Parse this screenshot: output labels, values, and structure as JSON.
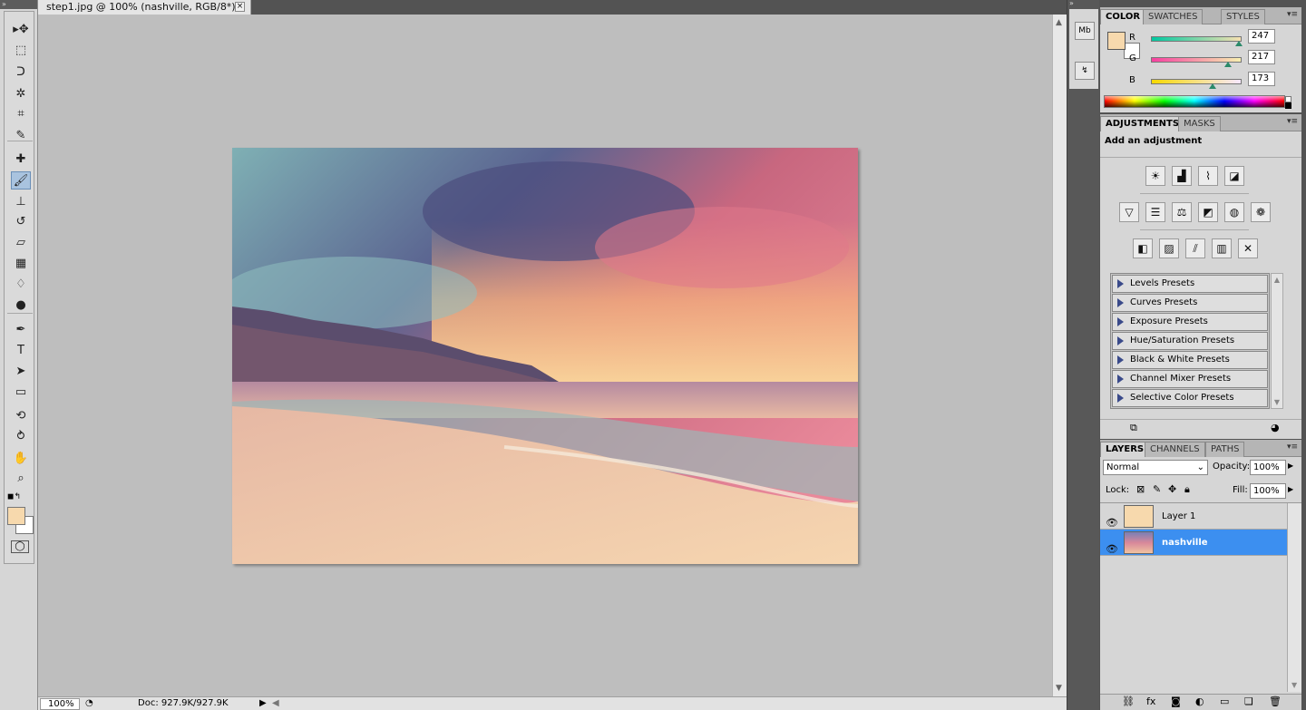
{
  "document": {
    "tab_title": "step1.jpg @ 100% (nashville, RGB/8*) *",
    "close_glyph": "×",
    "zoom": "100%",
    "doc_info": "Doc: 927.9K/927.9K"
  },
  "toolbox": {
    "collapse_glyph": "»",
    "tools": [
      {
        "name": "move-tool-icon",
        "glyph": "▸✥"
      },
      {
        "name": "marquee-tool-icon",
        "glyph": "⬚"
      },
      {
        "name": "lasso-tool-icon",
        "glyph": "ᑐ"
      },
      {
        "name": "magic-wand-tool-icon",
        "glyph": "✲"
      },
      {
        "name": "crop-tool-icon",
        "glyph": "⌗"
      },
      {
        "name": "eyedropper-tool-icon",
        "glyph": "✎"
      },
      {
        "name": "healing-brush-tool-icon",
        "glyph": "✚"
      },
      {
        "name": "brush-tool-icon",
        "glyph": "🖌"
      },
      {
        "name": "clone-stamp-tool-icon",
        "glyph": "⊥"
      },
      {
        "name": "history-brush-tool-icon",
        "glyph": "↺"
      },
      {
        "name": "eraser-tool-icon",
        "glyph": "▱"
      },
      {
        "name": "gradient-tool-icon",
        "glyph": "▦"
      },
      {
        "name": "blur-tool-icon",
        "glyph": "♢"
      },
      {
        "name": "dodge-tool-icon",
        "glyph": "●"
      },
      {
        "name": "pen-tool-icon",
        "glyph": "✒"
      },
      {
        "name": "type-tool-icon",
        "glyph": "T"
      },
      {
        "name": "path-selection-tool-icon",
        "glyph": "➤"
      },
      {
        "name": "rectangle-tool-icon",
        "glyph": "▭"
      },
      {
        "name": "3d-rotate-tool-icon",
        "glyph": "⟲"
      },
      {
        "name": "3d-orbit-tool-icon",
        "glyph": "⥁"
      },
      {
        "name": "hand-tool-icon",
        "glyph": "✋"
      },
      {
        "name": "zoom-tool-icon",
        "glyph": "⌕"
      }
    ],
    "foreground_color": "#f7d9ad",
    "background_color": "#ffffff"
  },
  "dock": {
    "collapse_glyph": "»",
    "mini_bridge_label": "Mb",
    "history_glyph": "↯"
  },
  "color_panel": {
    "tabs": [
      "COLOR",
      "SWATCHES",
      "STYLES"
    ],
    "menu_glyph": "▾≡",
    "channels": [
      {
        "label": "R",
        "value": "247",
        "fraction": 0.969,
        "gradient": "linear-gradient(to right,#00c8a0,#f7e0b0)"
      },
      {
        "label": "G",
        "value": "217",
        "fraction": 0.851,
        "gradient": "linear-gradient(to right,#f740a0,#f7f0b0)"
      },
      {
        "label": "B",
        "value": "173",
        "fraction": 0.678,
        "gradient": "linear-gradient(to right,#f7d900,#f7e8ff)"
      }
    ]
  },
  "adjustments_panel": {
    "tabs": [
      "ADJUSTMENTS",
      "MASKS"
    ],
    "menu_glyph": "▾≡",
    "heading": "Add an adjustment",
    "row1": [
      "brightness-contrast-icon",
      "levels-icon",
      "curves-icon",
      "exposure-icon"
    ],
    "row1_glyphs": [
      "☀",
      "▟",
      "⌇",
      "◪"
    ],
    "row2": [
      "vibrance-icon",
      "hue-saturation-icon",
      "color-balance-icon",
      "black-white-icon",
      "photo-filter-icon",
      "channel-mixer-icon"
    ],
    "row2_glyphs": [
      "▽",
      "☰",
      "⚖",
      "◩",
      "◍",
      "❁"
    ],
    "row3": [
      "invert-icon",
      "posterize-icon",
      "threshold-icon",
      "gradient-map-icon",
      "selective-color-icon"
    ],
    "row3_glyphs": [
      "◧",
      "▨",
      "⫽",
      "▥",
      "✕"
    ],
    "presets": [
      "Levels Presets",
      "Curves Presets",
      "Exposure Presets",
      "Hue/Saturation Presets",
      "Black & White Presets",
      "Channel Mixer Presets",
      "Selective Color Presets"
    ]
  },
  "layers_panel": {
    "tabs": [
      "LAYERS",
      "CHANNELS",
      "PATHS"
    ],
    "menu_glyph": "▾≡",
    "blend_mode": "Normal",
    "opacity_label": "Opacity:",
    "opacity": "100%",
    "lock_label": "Lock:",
    "fill_label": "Fill:",
    "fill": "100%",
    "layers": [
      {
        "name": "Layer 1",
        "selected": false
      },
      {
        "name": "nashville",
        "selected": true
      }
    ],
    "footer_glyphs": [
      "⛓",
      "fx",
      "◙",
      "◐",
      "▭",
      "❏",
      "🗑"
    ]
  }
}
